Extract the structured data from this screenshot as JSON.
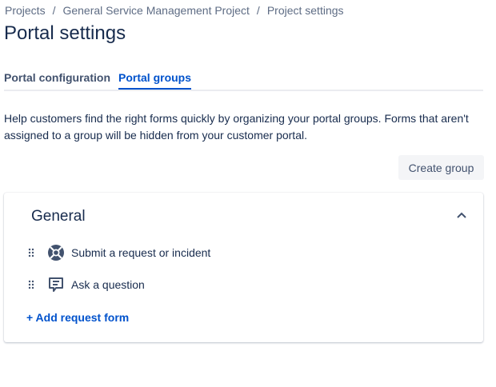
{
  "breadcrumb": [
    "Projects",
    "General Service Management Project",
    "Project settings"
  ],
  "page_title": "Portal settings",
  "tabs": [
    {
      "label": "Portal configuration",
      "active": false
    },
    {
      "label": "Portal groups",
      "active": true
    }
  ],
  "help_text": "Help customers find the right forms quickly by organizing your portal groups. Forms that aren't assigned to a group will be hidden from your customer portal.",
  "create_group_label": "Create group",
  "group": {
    "title": "General",
    "forms": [
      {
        "label": "Submit a request or incident",
        "icon": "lifebuoy-icon"
      },
      {
        "label": "Ask a question",
        "icon": "comment-icon"
      }
    ],
    "add_label": "+ Add request form"
  }
}
